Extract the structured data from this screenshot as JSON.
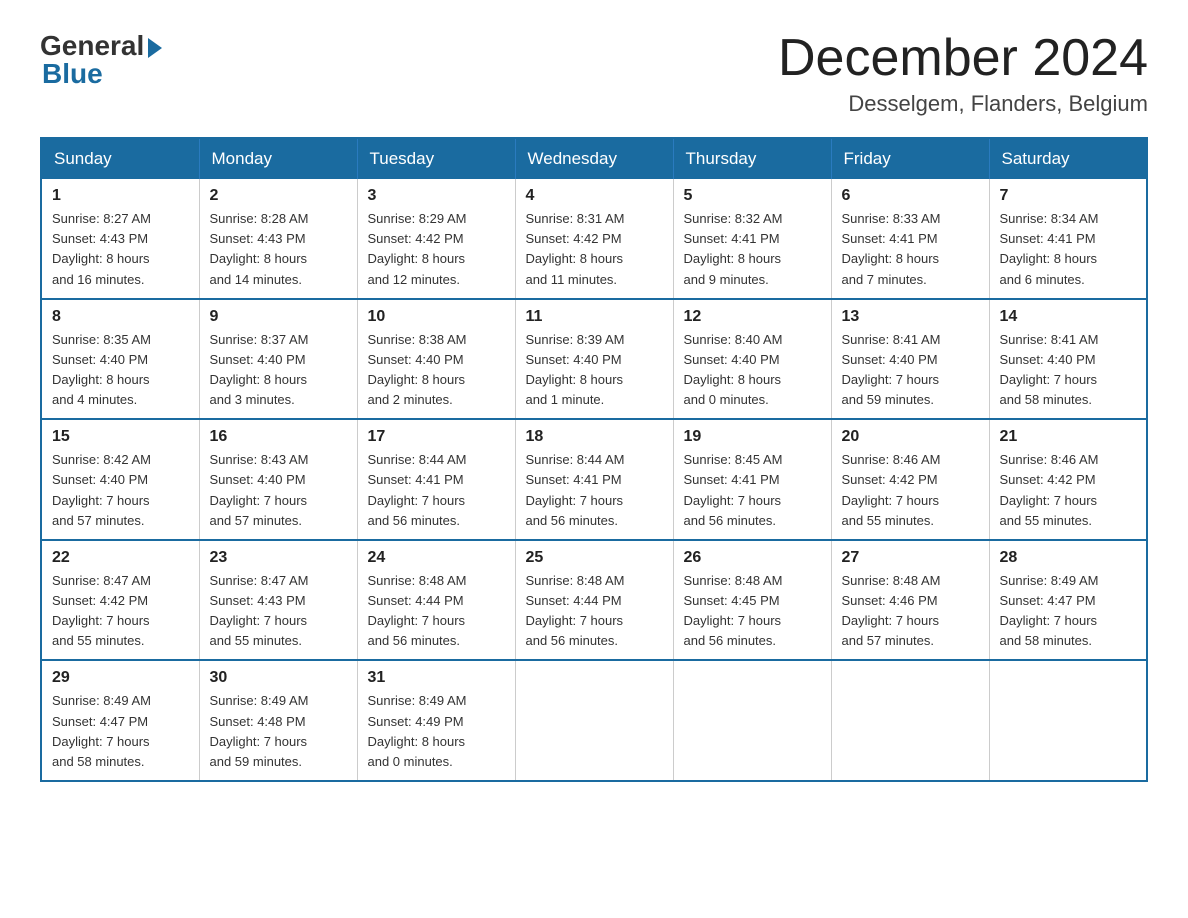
{
  "header": {
    "logo_general": "General",
    "logo_blue": "Blue",
    "month_title": "December 2024",
    "location": "Desselgem, Flanders, Belgium"
  },
  "calendar": {
    "days_of_week": [
      "Sunday",
      "Monday",
      "Tuesday",
      "Wednesday",
      "Thursday",
      "Friday",
      "Saturday"
    ],
    "weeks": [
      [
        {
          "day": "1",
          "info": "Sunrise: 8:27 AM\nSunset: 4:43 PM\nDaylight: 8 hours\nand 16 minutes."
        },
        {
          "day": "2",
          "info": "Sunrise: 8:28 AM\nSunset: 4:43 PM\nDaylight: 8 hours\nand 14 minutes."
        },
        {
          "day": "3",
          "info": "Sunrise: 8:29 AM\nSunset: 4:42 PM\nDaylight: 8 hours\nand 12 minutes."
        },
        {
          "day": "4",
          "info": "Sunrise: 8:31 AM\nSunset: 4:42 PM\nDaylight: 8 hours\nand 11 minutes."
        },
        {
          "day": "5",
          "info": "Sunrise: 8:32 AM\nSunset: 4:41 PM\nDaylight: 8 hours\nand 9 minutes."
        },
        {
          "day": "6",
          "info": "Sunrise: 8:33 AM\nSunset: 4:41 PM\nDaylight: 8 hours\nand 7 minutes."
        },
        {
          "day": "7",
          "info": "Sunrise: 8:34 AM\nSunset: 4:41 PM\nDaylight: 8 hours\nand 6 minutes."
        }
      ],
      [
        {
          "day": "8",
          "info": "Sunrise: 8:35 AM\nSunset: 4:40 PM\nDaylight: 8 hours\nand 4 minutes."
        },
        {
          "day": "9",
          "info": "Sunrise: 8:37 AM\nSunset: 4:40 PM\nDaylight: 8 hours\nand 3 minutes."
        },
        {
          "day": "10",
          "info": "Sunrise: 8:38 AM\nSunset: 4:40 PM\nDaylight: 8 hours\nand 2 minutes."
        },
        {
          "day": "11",
          "info": "Sunrise: 8:39 AM\nSunset: 4:40 PM\nDaylight: 8 hours\nand 1 minute."
        },
        {
          "day": "12",
          "info": "Sunrise: 8:40 AM\nSunset: 4:40 PM\nDaylight: 8 hours\nand 0 minutes."
        },
        {
          "day": "13",
          "info": "Sunrise: 8:41 AM\nSunset: 4:40 PM\nDaylight: 7 hours\nand 59 minutes."
        },
        {
          "day": "14",
          "info": "Sunrise: 8:41 AM\nSunset: 4:40 PM\nDaylight: 7 hours\nand 58 minutes."
        }
      ],
      [
        {
          "day": "15",
          "info": "Sunrise: 8:42 AM\nSunset: 4:40 PM\nDaylight: 7 hours\nand 57 minutes."
        },
        {
          "day": "16",
          "info": "Sunrise: 8:43 AM\nSunset: 4:40 PM\nDaylight: 7 hours\nand 57 minutes."
        },
        {
          "day": "17",
          "info": "Sunrise: 8:44 AM\nSunset: 4:41 PM\nDaylight: 7 hours\nand 56 minutes."
        },
        {
          "day": "18",
          "info": "Sunrise: 8:44 AM\nSunset: 4:41 PM\nDaylight: 7 hours\nand 56 minutes."
        },
        {
          "day": "19",
          "info": "Sunrise: 8:45 AM\nSunset: 4:41 PM\nDaylight: 7 hours\nand 56 minutes."
        },
        {
          "day": "20",
          "info": "Sunrise: 8:46 AM\nSunset: 4:42 PM\nDaylight: 7 hours\nand 55 minutes."
        },
        {
          "day": "21",
          "info": "Sunrise: 8:46 AM\nSunset: 4:42 PM\nDaylight: 7 hours\nand 55 minutes."
        }
      ],
      [
        {
          "day": "22",
          "info": "Sunrise: 8:47 AM\nSunset: 4:42 PM\nDaylight: 7 hours\nand 55 minutes."
        },
        {
          "day": "23",
          "info": "Sunrise: 8:47 AM\nSunset: 4:43 PM\nDaylight: 7 hours\nand 55 minutes."
        },
        {
          "day": "24",
          "info": "Sunrise: 8:48 AM\nSunset: 4:44 PM\nDaylight: 7 hours\nand 56 minutes."
        },
        {
          "day": "25",
          "info": "Sunrise: 8:48 AM\nSunset: 4:44 PM\nDaylight: 7 hours\nand 56 minutes."
        },
        {
          "day": "26",
          "info": "Sunrise: 8:48 AM\nSunset: 4:45 PM\nDaylight: 7 hours\nand 56 minutes."
        },
        {
          "day": "27",
          "info": "Sunrise: 8:48 AM\nSunset: 4:46 PM\nDaylight: 7 hours\nand 57 minutes."
        },
        {
          "day": "28",
          "info": "Sunrise: 8:49 AM\nSunset: 4:47 PM\nDaylight: 7 hours\nand 58 minutes."
        }
      ],
      [
        {
          "day": "29",
          "info": "Sunrise: 8:49 AM\nSunset: 4:47 PM\nDaylight: 7 hours\nand 58 minutes."
        },
        {
          "day": "30",
          "info": "Sunrise: 8:49 AM\nSunset: 4:48 PM\nDaylight: 7 hours\nand 59 minutes."
        },
        {
          "day": "31",
          "info": "Sunrise: 8:49 AM\nSunset: 4:49 PM\nDaylight: 8 hours\nand 0 minutes."
        },
        {
          "day": "",
          "info": ""
        },
        {
          "day": "",
          "info": ""
        },
        {
          "day": "",
          "info": ""
        },
        {
          "day": "",
          "info": ""
        }
      ]
    ]
  }
}
